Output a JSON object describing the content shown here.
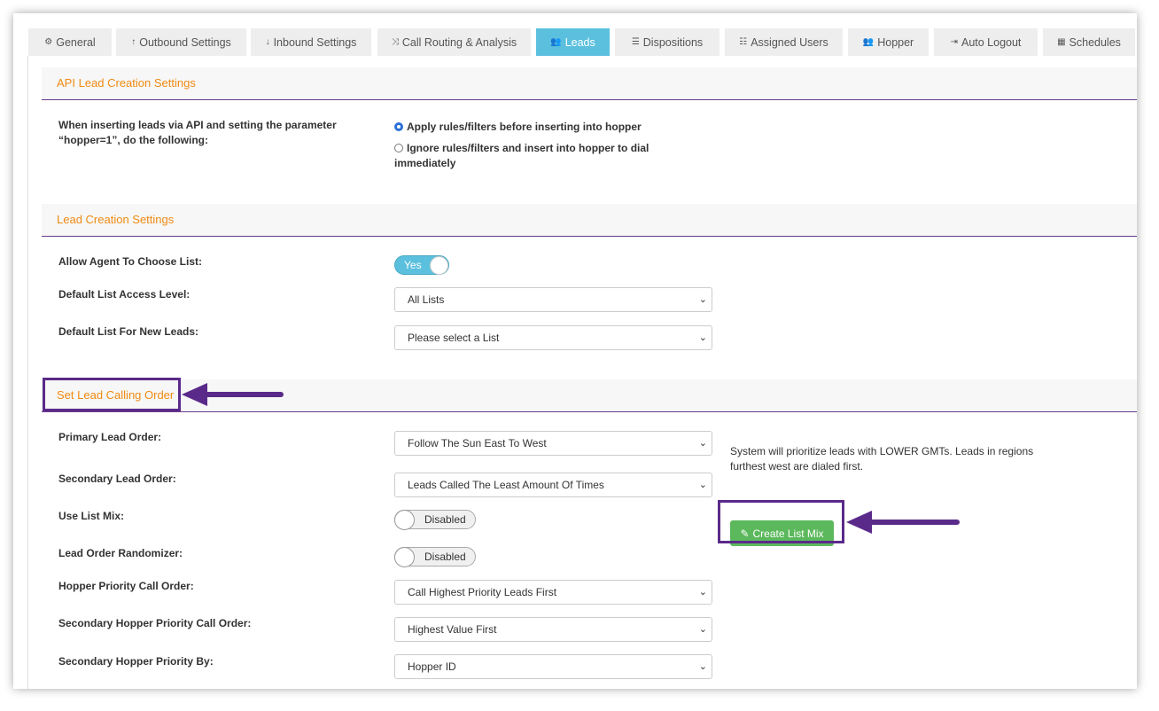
{
  "tabs": [
    {
      "icon": "⚙",
      "label": "General"
    },
    {
      "icon": "↑",
      "label": "Outbound Settings"
    },
    {
      "icon": "↓",
      "label": "Inbound Settings"
    },
    {
      "icon": "⤨",
      "label": "Call Routing & Analysis"
    },
    {
      "icon": "👥",
      "label": "Leads"
    },
    {
      "icon": "☰",
      "label": "Dispositions"
    },
    {
      "icon": "☷",
      "label": "Assigned Users"
    },
    {
      "icon": "👥",
      "label": "Hopper"
    },
    {
      "icon": "⇥",
      "label": "Auto Logout"
    },
    {
      "icon": "▦",
      "label": "Schedules"
    }
  ],
  "active_tab": "Leads",
  "api_section": {
    "title": "API Lead Creation Settings",
    "label_line1": "When inserting leads via API and setting the parameter",
    "label_line2": "“hopper=1”, do the following:",
    "option1": "Apply rules/filters before inserting into hopper",
    "option2_line1": "Ignore rules/filters and insert into hopper to dial",
    "option2_line2": "immediately",
    "selected_option": 1
  },
  "lead_creation": {
    "title": "Lead Creation Settings",
    "allow_agent_label": "Allow Agent To Choose List:",
    "allow_agent_value": "Yes",
    "access_level_label": "Default List Access Level:",
    "access_level_value": "All Lists",
    "default_list_label": "Default List For New Leads:",
    "default_list_value": "Please select a List"
  },
  "calling_order": {
    "title": "Set Lead Calling Order",
    "primary_label": "Primary Lead Order:",
    "primary_value": "Follow The Sun East To West",
    "primary_help_line1": "System will prioritize leads with LOWER GMTs. Leads in regions",
    "primary_help_line2": "furthest west are dialed first.",
    "secondary_label": "Secondary Lead Order:",
    "secondary_value": "Leads Called The Least Amount Of Times",
    "list_mix_label": "Use List Mix:",
    "list_mix_value": "Disabled",
    "create_list_mix": "Create List Mix",
    "randomizer_label": "Lead Order Randomizer:",
    "randomizer_value": "Disabled",
    "hopper_priority_label": "Hopper Priority Call Order:",
    "hopper_priority_value": "Call Highest Priority Leads First",
    "secondary_hopper_label": "Secondary Hopper Priority Call Order:",
    "secondary_hopper_value": "Highest Value First",
    "hopper_by_label": "Secondary Hopper Priority By:",
    "hopper_by_value": "Hopper ID"
  },
  "colors": {
    "accent_tab": "#5bc0de",
    "section_title": "#ef8a12",
    "annotation": "#5a2a8a",
    "button_green": "#5cb85c"
  }
}
